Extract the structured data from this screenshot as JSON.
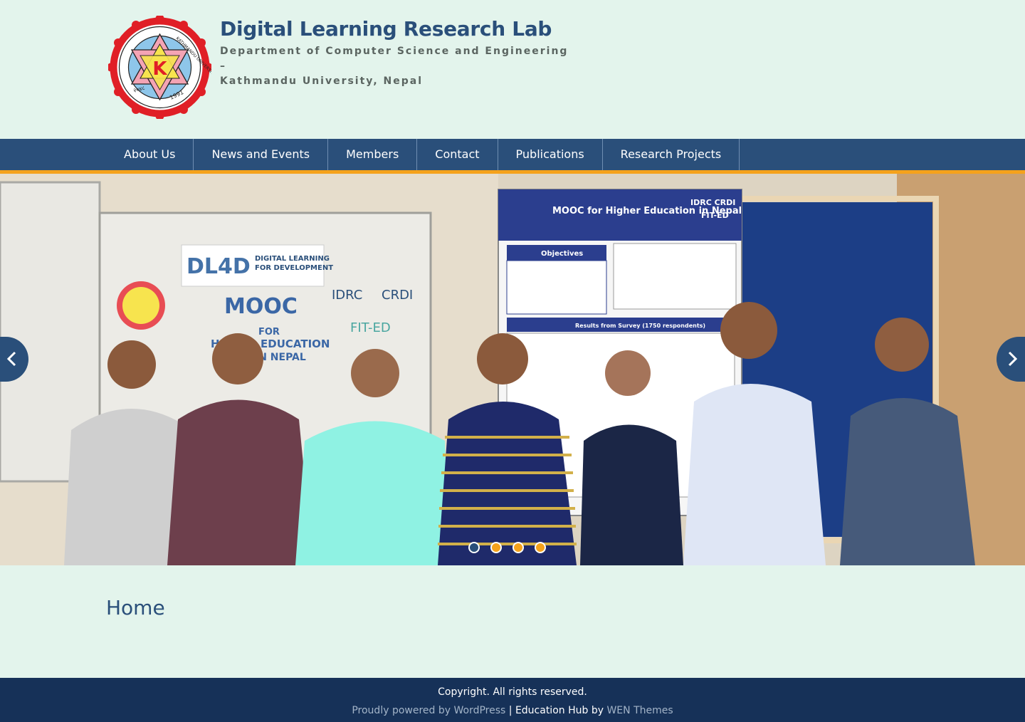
{
  "site": {
    "title": "Digital Learning Research Lab",
    "tagline_line1": "Department of Computer Science and Engineering",
    "tagline_line2": "–",
    "tagline_line3": "Kathmandu University, Nepal",
    "logo_text_top": "KATHMANDU UNIVERSITY",
    "logo_text_left": "काठमाडौं विश्वविद्यालय",
    "logo_year_left": "२०४८",
    "logo_year_right": "1991",
    "logo_mark": "K"
  },
  "nav": {
    "items": [
      {
        "label": "About Us"
      },
      {
        "label": "News and Events"
      },
      {
        "label": "Members"
      },
      {
        "label": "Contact"
      },
      {
        "label": "Publications"
      },
      {
        "label": "Research Projects"
      }
    ]
  },
  "slider": {
    "prev_icon": "chevron-left-icon",
    "next_icon": "chevron-right-icon",
    "active_index": 0,
    "slide_count": 4,
    "banner_left": {
      "logo_text": "DL4D",
      "logo_sub1": "DIGITAL LEARNING",
      "logo_sub2": "FOR DEVELOPMENT",
      "partner1": "IDRC",
      "partner2": "CRDI",
      "headline": "MOOC",
      "line2": "FOR",
      "line3": "HIGHER EDUCATION",
      "line4": "IN NEPAL",
      "fit": "FIT-ED"
    },
    "poster": {
      "title": "MOOC for Higher Education in Nepal",
      "objectives": "Objectives",
      "results": "Results from Survey (1750 respondents)",
      "partners": "IDRC CRDI",
      "fit": "FIT-ED"
    }
  },
  "content": {
    "page_title": "Home"
  },
  "footer": {
    "copyright": "Copyright. All rights reserved.",
    "powered": "Proudly powered by WordPress",
    "separator": " | ",
    "theme": "Education Hub by ",
    "author": "WEN Themes"
  },
  "colors": {
    "background": "#e3f4ec",
    "primary": "#2a4f7a",
    "accent": "#f5a21b",
    "footer": "#163158"
  }
}
